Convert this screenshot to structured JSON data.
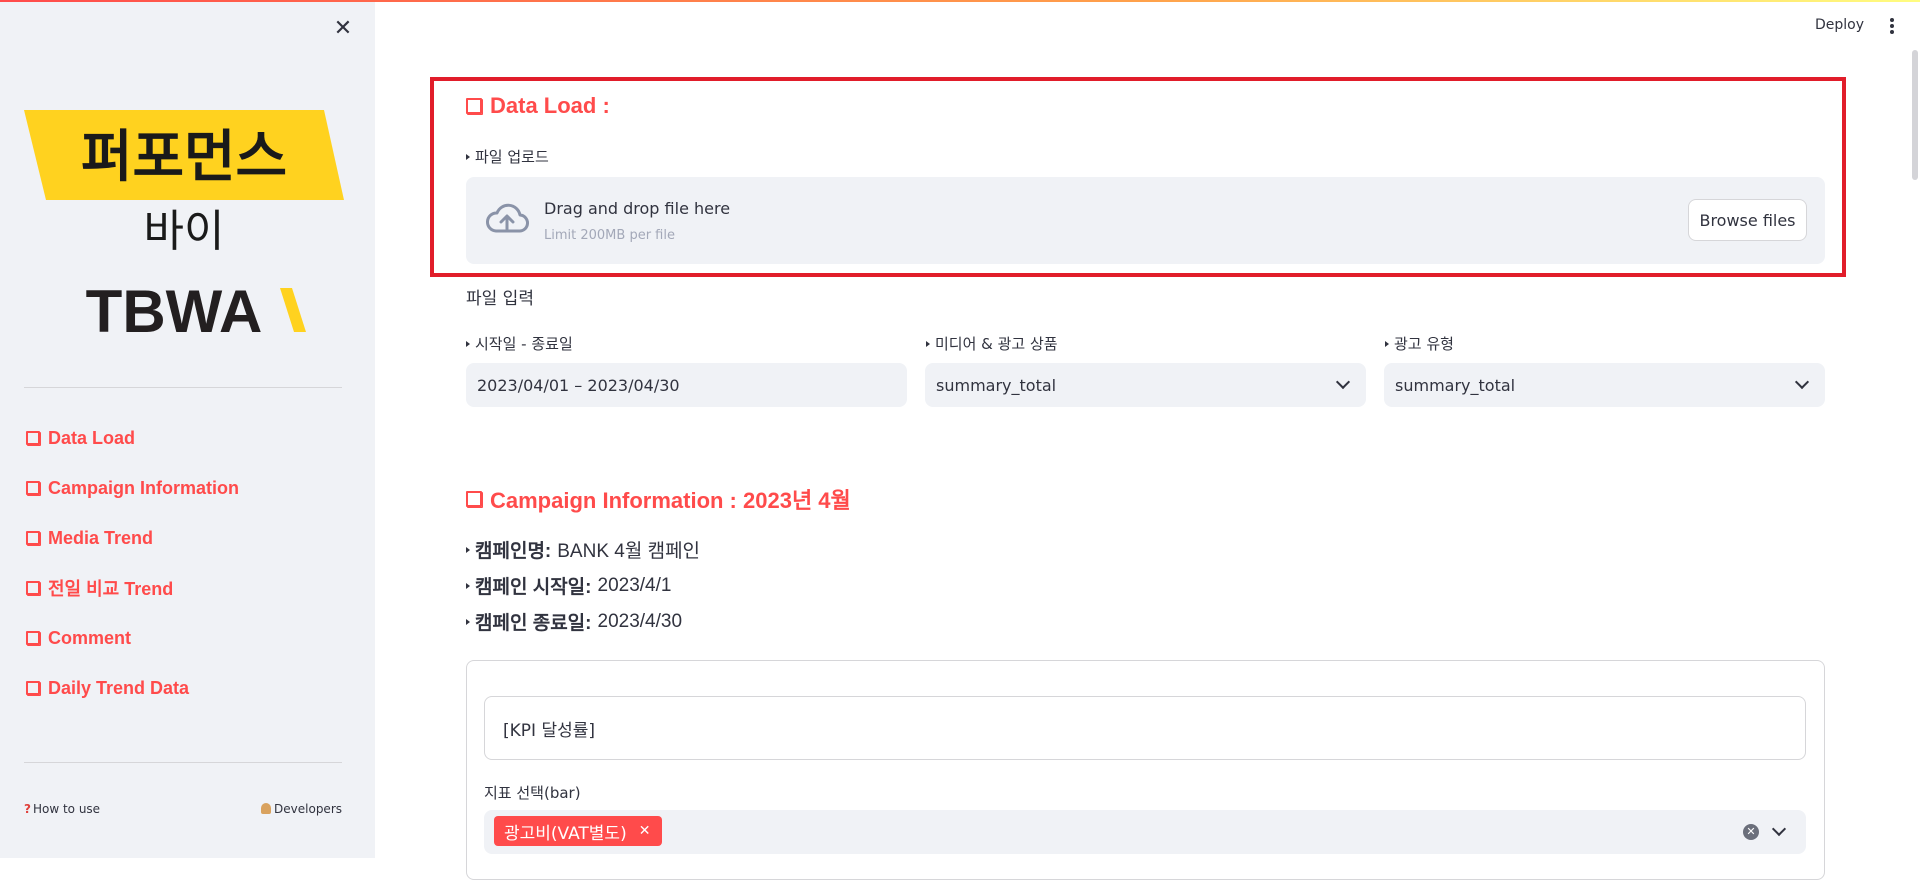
{
  "header": {
    "deploy_label": "Deploy",
    "close_glyph": "✕",
    "accent_gradient": [
      "#ff4b4b",
      "#ffa24b",
      "#fffd80"
    ]
  },
  "sidebar": {
    "logo": {
      "line1": "퍼포먼스",
      "line2": "바이",
      "line3": "TBWA",
      "banner_color": "#ffd21f"
    },
    "nav": [
      {
        "label": "Data Load"
      },
      {
        "label": "Campaign Information"
      },
      {
        "label": "Media Trend"
      },
      {
        "label": "전일 비교 Trend"
      },
      {
        "label": "Comment"
      },
      {
        "label": "Daily Trend Data"
      }
    ],
    "footer": {
      "how_to_use": "How to use",
      "developers": "Developers"
    }
  },
  "data_load": {
    "title": "Data Load :",
    "upload_label": "파일 업로드",
    "dropzone_title": "Drag and drop file here",
    "dropzone_limit": "Limit 200MB per file",
    "browse_label": "Browse files",
    "file_input_label": "파일 입력",
    "filters": [
      {
        "label": "시작일 - 종료일",
        "value": "2023/04/01 – 2023/04/30"
      },
      {
        "label": "미디어 & 광고 상품",
        "value": "summary_total"
      },
      {
        "label": "광고 유형",
        "value": "summary_total"
      }
    ]
  },
  "campaign": {
    "title": "Campaign Information : 2023년 4월",
    "lines": [
      {
        "key": "캠페인명:",
        "value": "BANK 4월 캠페인"
      },
      {
        "key": "캠페인 시작일:",
        "value": "2023/4/1"
      },
      {
        "key": "캠페인 종료일:",
        "value": "2023/4/30"
      }
    ],
    "kpi_box": "[KPI 달성률]",
    "metric_label": "지표 선택(bar)",
    "selected_tags": [
      "광고비(VAT별도)"
    ]
  },
  "colors": {
    "accent": "#ff4b4b",
    "highlight_border": "#e11d2a",
    "sidebar_bg": "#f0f2f6"
  }
}
